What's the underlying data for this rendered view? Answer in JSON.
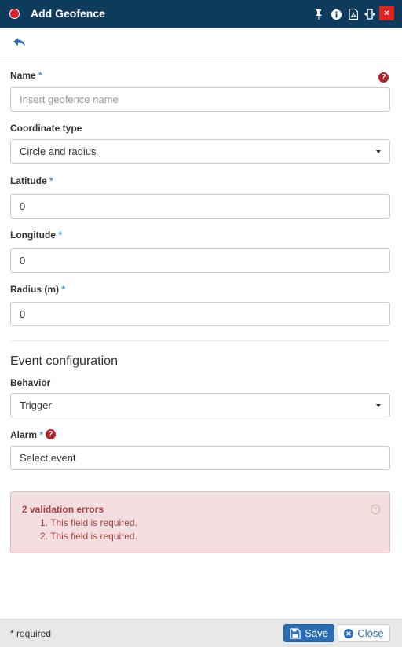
{
  "window": {
    "title": "Add Geofence",
    "title_icons": [
      "pin-icon",
      "info-icon",
      "pdf-icon",
      "resize-icon",
      "close-icon"
    ],
    "close_glyph": "×"
  },
  "form": {
    "name": {
      "label": "Name",
      "required_mark": "*",
      "placeholder": "Insert geofence name",
      "value": ""
    },
    "coordinate_type": {
      "label": "Coordinate type",
      "value": "Circle and radius"
    },
    "latitude": {
      "label": "Latitude",
      "required_mark": "*",
      "value": "0"
    },
    "longitude": {
      "label": "Longitude",
      "required_mark": "*",
      "value": "0"
    },
    "radius": {
      "label": "Radius (m)",
      "required_mark": "*",
      "value": "0"
    }
  },
  "event_config": {
    "section_title": "Event configuration",
    "behavior": {
      "label": "Behavior",
      "value": "Trigger"
    },
    "alarm": {
      "label": "Alarm",
      "required_mark": "*",
      "value": "Select event"
    }
  },
  "validation": {
    "title": "2 validation errors",
    "errors": [
      "1. This field is required.",
      "2. This field is required."
    ]
  },
  "footer": {
    "required_note": "* required",
    "save_label": "Save",
    "close_label": "Close"
  },
  "colors": {
    "header_bg": "#0e3a5c",
    "accent": "#2a6db5",
    "required_mark": "#3c9bd6",
    "error_bg": "#f2dede",
    "error_text": "#a94442",
    "close_red": "#e0231f"
  }
}
